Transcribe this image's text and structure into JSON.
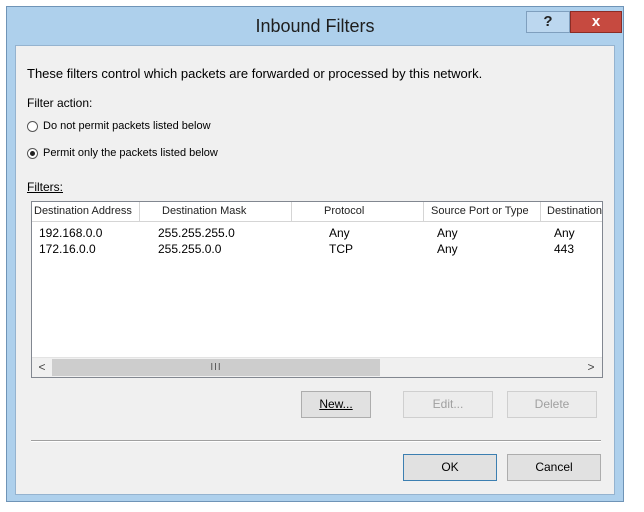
{
  "window": {
    "title": "Inbound Filters",
    "help_label": "?",
    "close_label": "x"
  },
  "description": "These filters control which packets are forwarded or processed by this network.",
  "filter_action": {
    "label": "Filter action:",
    "options": [
      {
        "label": "Do not permit packets listed below",
        "selected": false
      },
      {
        "label": "Permit only the packets listed below",
        "selected": true
      }
    ]
  },
  "filters": {
    "label": "Filters:",
    "columns": [
      "Destination Address",
      "Destination Mask",
      "Protocol",
      "Source Port or Type",
      "Destination"
    ],
    "rows": [
      [
        "192.168.0.0",
        "255.255.255.0",
        "Any",
        "Any",
        "Any"
      ],
      [
        "172.16.0.0",
        "255.255.0.0",
        "TCP",
        "Any",
        "443"
      ]
    ],
    "scroll_left": "<",
    "scroll_right": ">",
    "scroll_thumb": "III"
  },
  "buttons": {
    "new": "New...",
    "edit": "Edit...",
    "delete": "Delete",
    "ok": "OK",
    "cancel": "Cancel"
  }
}
